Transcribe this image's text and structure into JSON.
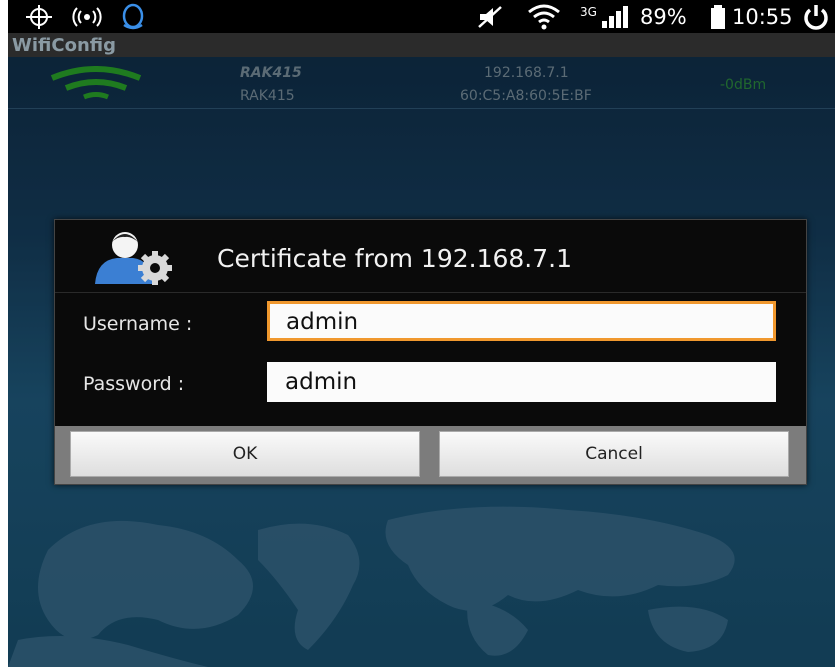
{
  "status_bar": {
    "network_type": "3G",
    "battery": "89%",
    "time": "10:55"
  },
  "app": {
    "title": "WifiConfig"
  },
  "network": {
    "ssid_primary": "RAK415",
    "ssid_secondary": "RAK415",
    "ip": "192.168.7.1",
    "mac": "60:C5:A8:60:5E:BF",
    "signal": "-0dBm"
  },
  "dialog": {
    "title": "Certificate from 192.168.7.1",
    "username_label": "Username :",
    "username_value": "admin",
    "password_label": "Password :",
    "password_value": "admin",
    "ok_label": "OK",
    "cancel_label": "Cancel"
  },
  "colors": {
    "accent_focus": "#f0982e",
    "signal_green": "#2aa52a",
    "background_top": "#0f2b45"
  },
  "icons": [
    "gps-icon",
    "cast-icon",
    "qq-icon",
    "mute-icon",
    "wifi-icon",
    "signal-bars-icon",
    "battery-icon",
    "power-icon",
    "wifi-signal-icon",
    "user-settings-icon"
  ]
}
